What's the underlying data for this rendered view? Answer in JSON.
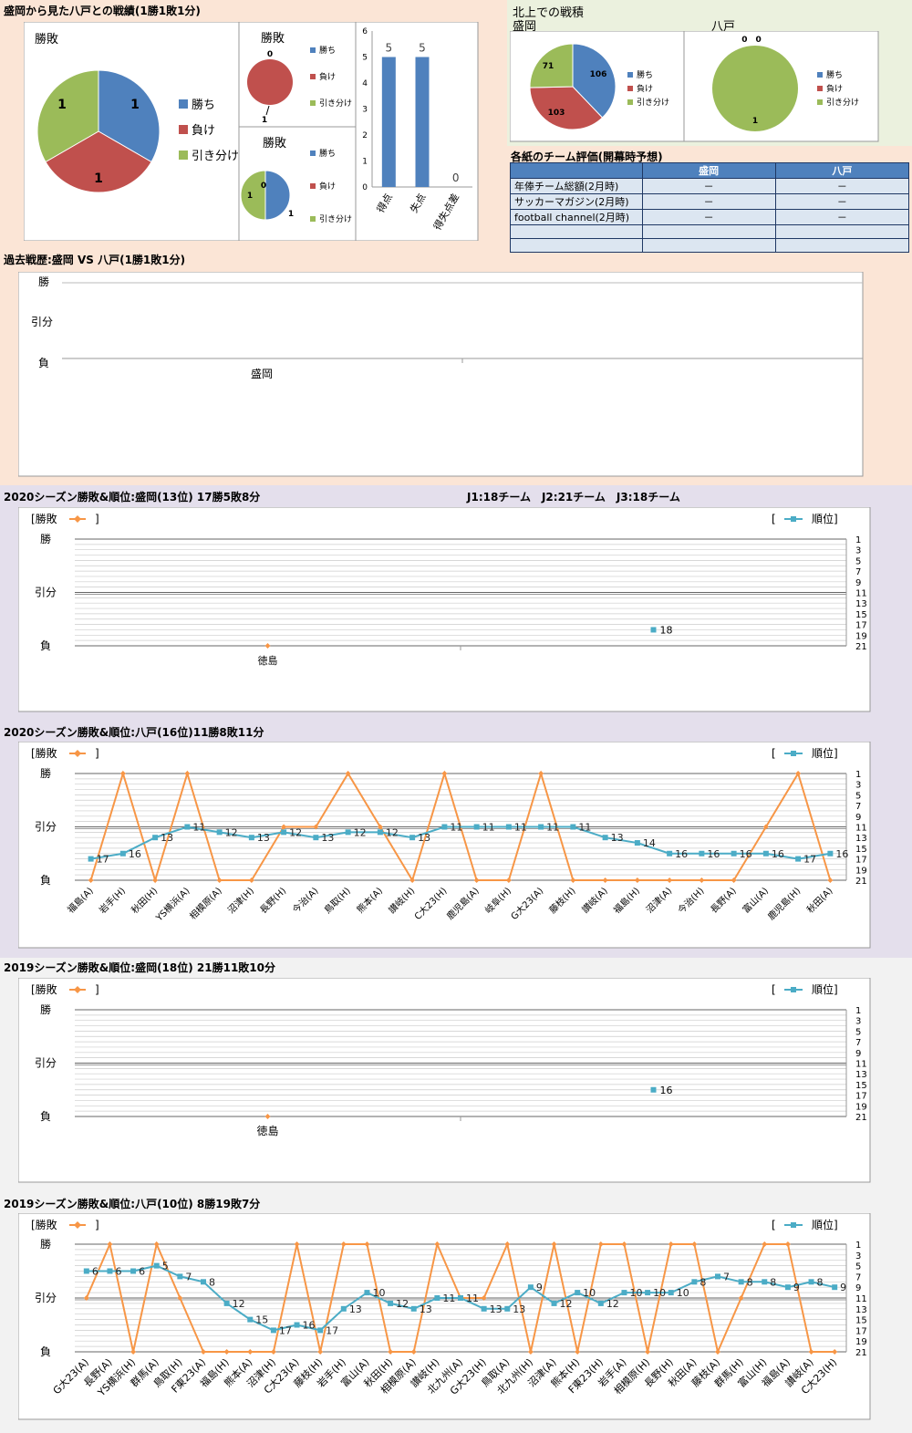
{
  "colors": {
    "win": "#4f81bd",
    "lose": "#c0504d",
    "draw": "#9bbb59",
    "orange": "#f79646",
    "teal": "#4bacc6",
    "bg_top": "#fbe5d6",
    "bg_mid": "#e4dfec",
    "bg_bot": "#f2f2f2",
    "bg_right": "#ebf1de"
  },
  "legend": {
    "win": "勝ち",
    "lose": "負け",
    "draw": "引き分け"
  },
  "h2h": {
    "title": "盛岡から見た八戸との戦績(1勝1敗1分)",
    "pie_title": "勝敗",
    "home_title": "勝敗",
    "away_title": "勝敗"
  },
  "kitakami": {
    "title": "北上での戦積",
    "left": "盛岡",
    "right": "八戸"
  },
  "eval": {
    "title": "各紙のチーム評価(開幕時予想)",
    "headers": [
      "",
      "盛岡",
      "八戸"
    ],
    "rows": [
      [
        "年俸チーム総額(2月時)",
        "－",
        "－"
      ],
      [
        "サッカーマガジン(2月時)",
        "－",
        "－"
      ],
      [
        "football channel(2月時)",
        "－",
        "－"
      ],
      [
        "",
        "",
        ""
      ],
      [
        "",
        "",
        ""
      ]
    ]
  },
  "past": {
    "title": "過去戦歴:盛岡 VS 八戸(1勝1敗1分)",
    "y_win": "勝",
    "y_draw": "引分",
    "y_lose": "負",
    "x_label": "盛岡"
  },
  "info": "J1:18チーム　J2:21チーム　J3:18チーム",
  "common": {
    "legend_result": "[勝敗",
    "legend_result_end": "]",
    "legend_rank_start": "[",
    "legend_rank": "順位]",
    "y_win": "勝",
    "y_draw": "引分",
    "y_lose": "負"
  },
  "s1_title": "2020シーズン勝敗&順位:盛岡(13位) 17勝5敗8分",
  "s2_title": "2020シーズン勝敗&順位:八戸(16位)11勝8敗11分",
  "s3_title": "2019シーズン勝敗&順位:盛岡(18位) 21勝11敗10分",
  "s4_title": "2019シーズン勝敗&順位:八戸(10位) 8勝19敗7分",
  "chart_data": [
    {
      "type": "pie",
      "id": "h2h_total",
      "title": "勝敗",
      "labels": [
        "勝ち",
        "負け",
        "引き分け"
      ],
      "values": [
        1,
        1,
        1
      ]
    },
    {
      "type": "pie",
      "id": "h2h_home",
      "title": "勝敗",
      "labels": [
        "勝ち",
        "負け",
        "引き分け"
      ],
      "values": [
        0,
        1,
        0
      ]
    },
    {
      "type": "pie",
      "id": "h2h_away",
      "title": "勝敗",
      "labels": [
        "勝ち",
        "負け",
        "引き分け"
      ],
      "values": [
        1,
        0,
        1
      ]
    },
    {
      "type": "bar",
      "id": "goals",
      "categories": [
        "得点",
        "失点",
        "得失点差"
      ],
      "values": [
        5,
        5,
        0
      ],
      "ylim": [
        0,
        6
      ]
    },
    {
      "type": "pie",
      "id": "kitakami_morioka",
      "labels": [
        "勝ち",
        "負け",
        "引き分け"
      ],
      "values": [
        106,
        103,
        71
      ]
    },
    {
      "type": "pie",
      "id": "kitakami_hachinohe",
      "labels": [
        "勝ち",
        "負け",
        "引き分け"
      ],
      "values": [
        0,
        0,
        1
      ]
    },
    {
      "type": "line",
      "id": "past",
      "categories": [
        "盛岡"
      ],
      "results": []
    },
    {
      "type": "line",
      "id": "s2020_morioka",
      "categories": [
        "徳島"
      ],
      "results": [
        "L"
      ],
      "rank": [
        18
      ],
      "rank_range": [
        1,
        21
      ]
    },
    {
      "type": "line",
      "id": "s2020_hachinohe",
      "categories": [
        "福島(A)",
        "岩手(H)",
        "秋田(H)",
        "YS横浜(A)",
        "相模原(A)",
        "沼津(H)",
        "長野(H)",
        "今治(A)",
        "鳥取(H)",
        "熊本(A)",
        "讃岐(H)",
        "C大23(H)",
        "鹿児島(A)",
        "岐阜(H)",
        "G大23(A)",
        "藤枝(H)",
        "讃岐(A)",
        "福島(H)",
        "沼津(A)",
        "今治(H)",
        "長野(A)",
        "富山(A)",
        "鹿児島(H)",
        "秋田(A)"
      ],
      "results": [
        "L",
        "W",
        "L",
        "W",
        "L",
        "L",
        "D",
        "D",
        "W",
        "D",
        "L",
        "W",
        "L",
        "L",
        "W",
        "L",
        "L",
        "L",
        "L",
        "L",
        "L",
        "D",
        "W",
        "L"
      ],
      "rank": [
        17,
        16,
        13,
        11,
        12,
        13,
        12,
        13,
        12,
        12,
        13,
        11,
        11,
        11,
        11,
        11,
        13,
        14,
        16,
        16,
        16,
        16,
        17,
        16
      ],
      "rank_range": [
        1,
        21
      ]
    },
    {
      "type": "line",
      "id": "s2019_morioka",
      "categories": [
        "徳島"
      ],
      "results": [
        "L"
      ],
      "rank": [
        16
      ],
      "rank_range": [
        1,
        21
      ]
    },
    {
      "type": "line",
      "id": "s2019_hachinohe",
      "categories": [
        "G大23(A)",
        "長野(A)",
        "YS横浜(H)",
        "群馬(A)",
        "鳥取(H)",
        "F東23(A)",
        "福島(H)",
        "熊本(A)",
        "沼津(H)",
        "C大23(A)",
        "藤枝(H)",
        "岩手(H)",
        "富山(A)",
        "秋田(H)",
        "相模原(A)",
        "讃岐(H)",
        "北九州(A)",
        "G大23(H)",
        "鳥取(A)",
        "北九州(H)",
        "沼津(A)",
        "熊本(H)",
        "F東23(H)",
        "岩手(A)",
        "相模原(H)",
        "長野(H)",
        "秋田(A)",
        "藤枝(A)",
        "群馬(H)",
        "富山(H)",
        "福島(A)",
        "讃岐(A)",
        "C大23(H)"
      ],
      "results": [
        "D",
        "W",
        "L",
        "W",
        "D",
        "L",
        "L",
        "L",
        "L",
        "W",
        "L",
        "W",
        "W",
        "L",
        "L",
        "W",
        "D",
        "D",
        "W",
        "L",
        "W",
        "L",
        "W",
        "W",
        "L",
        "W",
        "W",
        "L",
        "D",
        "W",
        "W",
        "L",
        "L"
      ],
      "rank": [
        6,
        6,
        6,
        5,
        7,
        8,
        12,
        15,
        17,
        16,
        17,
        13,
        10,
        12,
        13,
        11,
        11,
        13,
        13,
        9,
        12,
        10,
        12,
        10,
        10,
        10,
        8,
        7,
        8,
        8,
        9,
        8,
        9
      ],
      "rank_range": [
        1,
        21
      ]
    }
  ]
}
